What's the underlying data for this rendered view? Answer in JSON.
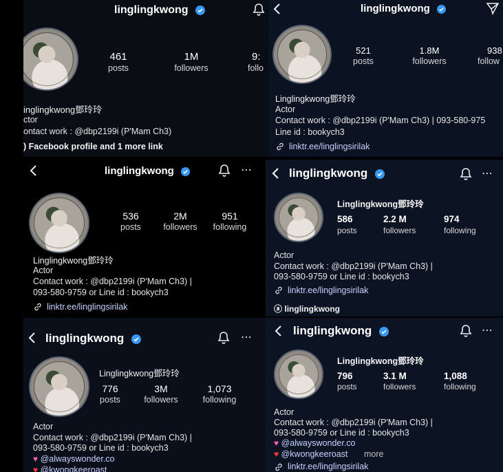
{
  "verify_color": "#3897f0",
  "panel1": {
    "username": "linglingkwong",
    "stats": [
      {
        "value": "461",
        "label": "posts"
      },
      {
        "value": "1M",
        "label": "followers"
      },
      {
        "value": "9:",
        "label": "follo"
      }
    ],
    "fullname": "inglingkwong鄧玲玲",
    "category": "ctor",
    "bio": "ontact work : @dbp2199i (P'Mam Ch3)",
    "link": ") Facebook profile and 1 more link"
  },
  "panel2": {
    "username": "linglingkwong",
    "stats": [
      {
        "value": "521",
        "label": "posts"
      },
      {
        "value": "1.8M",
        "label": "followers"
      },
      {
        "value": "938",
        "label": "follow"
      }
    ],
    "fullname": "Linglingkwong鄧玲玲",
    "category": "Actor",
    "bio1": "Contact work : @dbp2199i (P'Mam Ch3) | 093-580-975",
    "bio2": "Line id : bookych3",
    "link": "linktr.ee/linglingsirilak"
  },
  "panel3": {
    "username": "linglingkwong",
    "stats": [
      {
        "value": "536",
        "label": "posts"
      },
      {
        "value": "2M",
        "label": "followers"
      },
      {
        "value": "951",
        "label": "following"
      }
    ],
    "fullname": "Linglingkwong鄧玲玲",
    "category": "Actor",
    "bio1": "Contact work : @dbp2199i (P'Mam Ch3) |",
    "bio2": "093-580-9759 or Line id : bookych3",
    "link": "linktr.ee/linglingsirilak"
  },
  "panel4": {
    "username": "linglingkwong",
    "fullname": "Linglingkwong鄧玲玲",
    "stats": [
      {
        "value": "586",
        "label": "posts"
      },
      {
        "value": "2.2 M",
        "label": "followers"
      },
      {
        "value": "974",
        "label": "following"
      }
    ],
    "category": "Actor",
    "bio1": "Contact work : @dbp2199i (P'Mam Ch3) |",
    "bio2": "093-580-9759 or Line id : bookych3",
    "link": "linktr.ee/linglingsirilak",
    "threads": "linglingkwong"
  },
  "panel5": {
    "username": "linglingkwong",
    "fullname": "Linglingkwong鄧玲玲",
    "stats": [
      {
        "value": "776",
        "label": "posts"
      },
      {
        "value": "3M",
        "label": "followers"
      },
      {
        "value": "1,073",
        "label": "following"
      }
    ],
    "category": "Actor",
    "bio1": "Contact work : @dbp2199i (P'Mam Ch3) |",
    "bio2": "093-580-9759 or Line id : bookych3",
    "link1": "@alwayswonder.co",
    "link2": "@kwongkeeroast"
  },
  "panel6": {
    "username": "linglingkwong",
    "fullname": "Linglingkwong鄧玲玲",
    "stats": [
      {
        "value": "796",
        "label": "posts"
      },
      {
        "value": "3.1 M",
        "label": "followers"
      },
      {
        "value": "1,088",
        "label": "following"
      }
    ],
    "category": "Actor",
    "bio1": "Contact work : @dbp2199i (P'Mam Ch3) |",
    "bio2": "093-580-9759 or Line id : bookych3",
    "link1": "@alwayswonder.co",
    "link2": "@kwongkeeroast",
    "more": "more",
    "link3": "linktr.ee/linglingsirilak"
  }
}
